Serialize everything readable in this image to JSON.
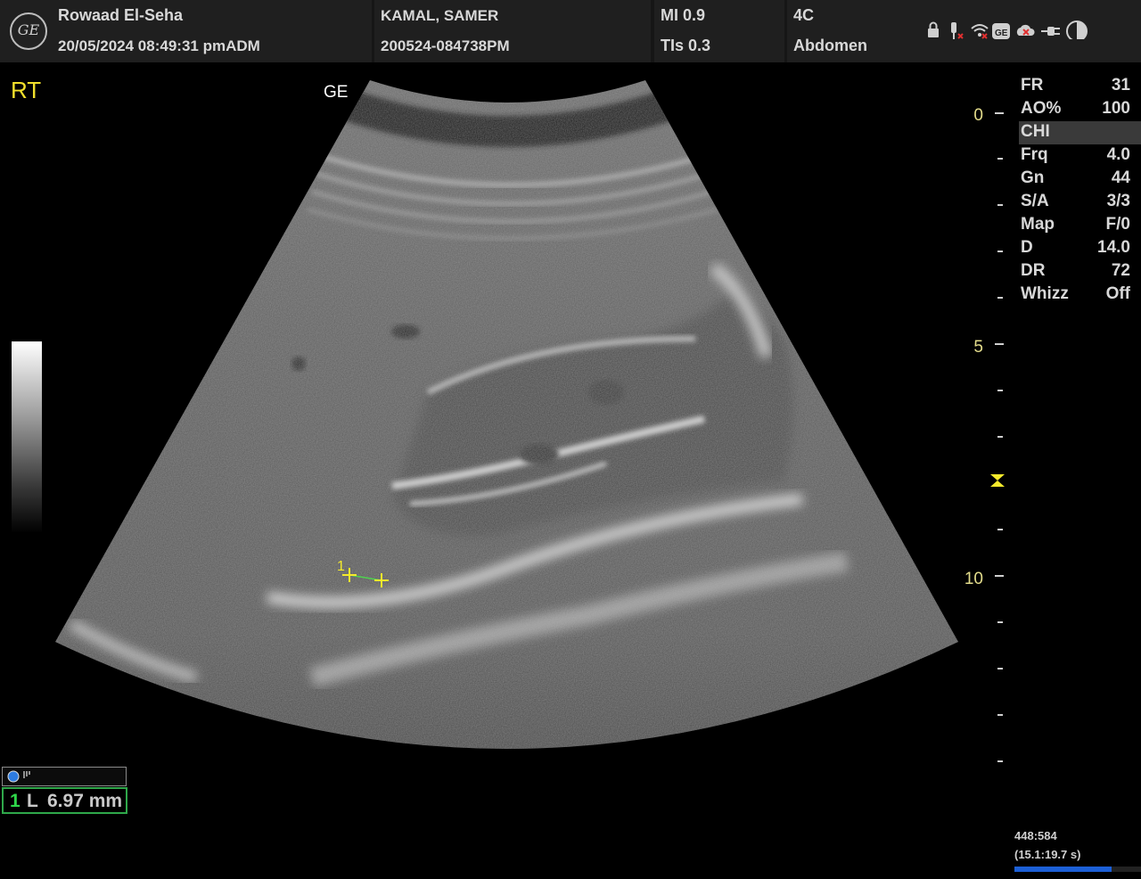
{
  "header": {
    "institution": "Rowaad El-Seha",
    "datetime": "20/05/2024 08:49:31 pmADM",
    "patient_name": "KAMAL, SAMER",
    "exam_id": "200524-084738PM",
    "mi": "MI 0.9",
    "tis": "TIs 0.3",
    "probe": "4C",
    "preset": "Abdomen",
    "logo_text": "GE"
  },
  "system_icons": [
    "lock-icon",
    "probe-disconnected-icon",
    "wireless-off-icon",
    "ge-service-icon",
    "network-error-icon",
    "power-plug-icon",
    "brightness-icon"
  ],
  "image": {
    "orientation": "RT",
    "probe_mark": "GE",
    "depth_labels": [
      "0",
      "5",
      "10"
    ]
  },
  "params": [
    {
      "key": "FR",
      "value": "31"
    },
    {
      "key": "AO%",
      "value": "100"
    },
    {
      "key": "CHI",
      "value": ""
    },
    {
      "key": "Frq",
      "value": "4.0"
    },
    {
      "key": "Gn",
      "value": "44"
    },
    {
      "key": "S/A",
      "value": "3/3"
    },
    {
      "key": "Map",
      "value": "F/0"
    },
    {
      "key": "D",
      "value": "14.0"
    },
    {
      "key": "DR",
      "value": "72"
    },
    {
      "key": "Whizz",
      "value": "Off"
    }
  ],
  "measurement": {
    "number": "1",
    "type": "L",
    "value": "6.97 mm",
    "caliper_label": "1"
  },
  "frame": {
    "count": "448:584",
    "time": "(15.1:19.7 s)",
    "cine_progress": 0.77
  },
  "colors": {
    "accent_yellow": "#f5ea2b",
    "measure_green": "#2fa84a",
    "cine_blue": "#1c5fd6"
  }
}
